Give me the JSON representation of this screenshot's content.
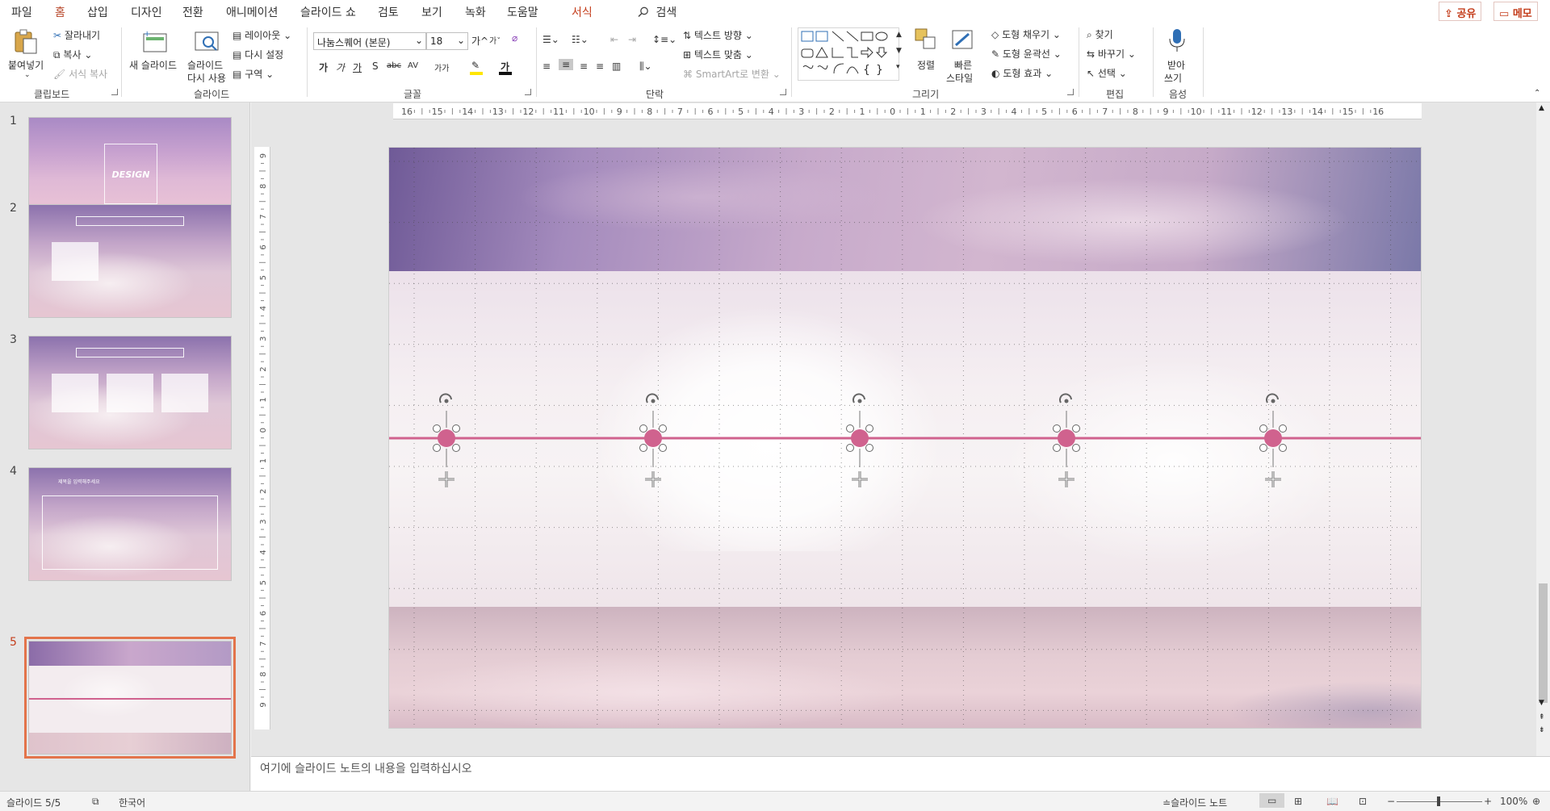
{
  "tabs": [
    "파일",
    "홈",
    "삽입",
    "디자인",
    "전환",
    "애니메이션",
    "슬라이드 쇼",
    "검토",
    "보기",
    "녹화",
    "도움말",
    "서식"
  ],
  "search": {
    "label": "검색"
  },
  "top_buttons": {
    "share": "공유",
    "comment": "메모"
  },
  "ribbon": {
    "clipboard": {
      "paste": "붙여넣기",
      "cut": "잘라내기",
      "copy": "복사",
      "format_painter": "서식 복사",
      "group": "클립보드"
    },
    "slides": {
      "new_slide": "새 슬라이드",
      "reuse_slides_1": "슬라이드",
      "reuse_slides_2": "다시 사용",
      "layout": "레이아웃",
      "reset": "다시 설정",
      "section": "구역",
      "group": "슬라이드"
    },
    "font": {
      "font_name": "나눔스퀘어 (본문)",
      "font_size": "18",
      "group": "글꼴",
      "bold": "가",
      "italic": "가",
      "underline": "가",
      "shadow": "S",
      "strike": "abc",
      "spacing": "AV",
      "case": "가가",
      "grow": "가",
      "shrink": "가",
      "color_a": "가"
    },
    "paragraph": {
      "text_direction": "텍스트 방향",
      "align_text": "텍스트 맞춤",
      "smartart": "SmartArt로 변환",
      "group": "단락"
    },
    "drawing": {
      "arrange": "정렬",
      "quick_styles_1": "빠른",
      "quick_styles_2": "스타일",
      "shape_fill": "도형 채우기",
      "shape_outline": "도형 윤곽선",
      "shape_effects": "도형 효과",
      "group": "그리기"
    },
    "editing": {
      "find": "찾기",
      "replace": "바꾸기",
      "select": "선택",
      "group": "편집"
    },
    "voice": {
      "dictate_1": "받아",
      "dictate_2": "쓰기",
      "group": "음성"
    }
  },
  "thumbnails": [
    {
      "num": "1",
      "title": "DESIGN"
    },
    {
      "num": "2"
    },
    {
      "num": "3"
    },
    {
      "num": "4",
      "title": "제목을 입력해주세요"
    },
    {
      "num": "5"
    }
  ],
  "ruler_h": [
    "16",
    "15",
    "14",
    "13",
    "12",
    "11",
    "10",
    "9",
    "8",
    "7",
    "6",
    "5",
    "4",
    "3",
    "2",
    "1",
    "0",
    "1",
    "2",
    "3",
    "4",
    "5",
    "6",
    "7",
    "8",
    "9",
    "10",
    "11",
    "12",
    "13",
    "14",
    "15",
    "16"
  ],
  "ruler_v": [
    "9",
    "8",
    "7",
    "6",
    "5",
    "4",
    "3",
    "2",
    "1",
    "0",
    "1",
    "2",
    "3",
    "4",
    "5",
    "6",
    "7",
    "8",
    "9"
  ],
  "notes": {
    "placeholder": "여기에 슬라이드 노트의 내용을 입력하십시오"
  },
  "status": {
    "slide": "슬라이드 5/5",
    "language": "한국어",
    "notes": "슬라이드 노트",
    "zoom": "100%"
  },
  "colors": {
    "accent": "#c43e1c",
    "timeline": "#d0628e",
    "selection": "#e3744b"
  },
  "slide5": {
    "timeline_points": 5
  }
}
